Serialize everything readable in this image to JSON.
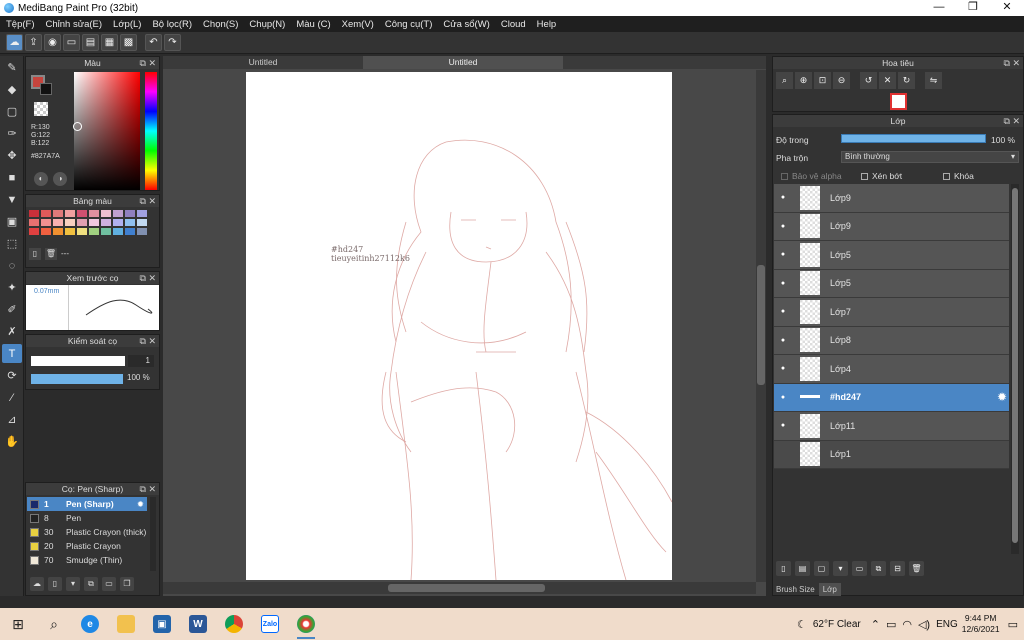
{
  "window": {
    "title": "MediBang Paint Pro (32bit)",
    "controls": [
      "—",
      "❐",
      "✕"
    ]
  },
  "menu": [
    "Tệp(F)",
    "Chỉnh sửa(E)",
    "Lớp(L)",
    "Bộ lọc(R)",
    "Chọn(S)",
    "Chụp(N)",
    "Màu (C)",
    "Xem(V)",
    "Công cụ(T)",
    "Cửa sổ(W)",
    "Cloud",
    "Help"
  ],
  "color_panel": {
    "title": "Màu",
    "r": "R:130",
    "g": "G:122",
    "b": "B:122",
    "hex": "#827A7A",
    "fg_color": "#c6443d"
  },
  "palette_panel": {
    "title": "Bảng màu",
    "footer_text": "---",
    "colors": [
      "#c8303a",
      "#e05a5a",
      "#e07a7a",
      "#f0a0a0",
      "#d05070",
      "#e090a0",
      "#f0c0d0",
      "#c0a0d0",
      "#9080c0",
      "#a0a0e0",
      "#e87070",
      "#f09090",
      "#f8b0b0",
      "#f8d0c0",
      "#e0a0b0",
      "#f0c8e0",
      "#d0b0e0",
      "#b0b0f0",
      "#90c0f0",
      "#c0d8f0",
      "#e04040",
      "#f06040",
      "#f09030",
      "#f0c040",
      "#f0e080",
      "#a0d080",
      "#70c0a0",
      "#60b0e0",
      "#4080d0",
      "#8090b0"
    ]
  },
  "preview_panel": {
    "title": "Xem trước cọ",
    "size": "0.07mm"
  },
  "control_panel": {
    "title": "Kiểm soát cọ",
    "size_value": "1",
    "opacity_value": "100 %"
  },
  "brush_panel": {
    "title": "Cọ: Pen (Sharp)",
    "items": [
      {
        "num": "1",
        "name": "Pen (Sharp)",
        "color": "#1a2a6a"
      },
      {
        "num": "8",
        "name": "Pen",
        "color": "#222222"
      },
      {
        "num": "30",
        "name": "Plastic Crayon (thick)",
        "color": "#e8d040"
      },
      {
        "num": "20",
        "name": "Plastic Crayon",
        "color": "#e8d040"
      },
      {
        "num": "70",
        "name": "Smudge (Thin)",
        "color": "#f0e8d8"
      }
    ]
  },
  "document": {
    "tabs": [
      "Untitled",
      "Untitled"
    ],
    "watermark_line1": "#hd247",
    "watermark_line2": "tieuyeitinh27112k6"
  },
  "navigator": {
    "title": "Hoa tiêu"
  },
  "layer_panel": {
    "title": "Lớp",
    "opacity_label": "Độ trong",
    "opacity_value": "100 %",
    "blend_label": "Pha trộn",
    "blend_value": "Bình thường",
    "protect_alpha": "Bảo vệ alpha",
    "clipping": "Xén bớt",
    "lock": "Khóa",
    "layers": [
      "Lớp9",
      "Lớp9",
      "Lớp5",
      "Lớp5",
      "Lớp7",
      "Lớp8",
      "Lớp4",
      "#hd247",
      "Lớp11",
      "Lớp1"
    ]
  },
  "bottom_tabs": [
    "Brush Size",
    "Lớp"
  ],
  "taskbar": {
    "weather": "62°F  Clear",
    "lang": "ENG",
    "time": "9:44 PM",
    "date": "12/6/2021"
  }
}
